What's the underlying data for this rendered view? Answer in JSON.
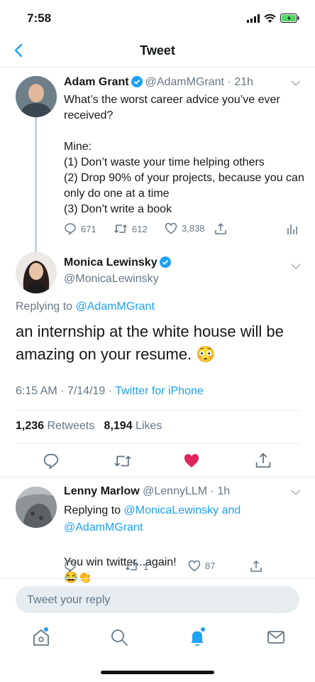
{
  "status": {
    "time": "7:58"
  },
  "header": {
    "title": "Tweet"
  },
  "parent_tweet": {
    "name": "Adam Grant",
    "handle": "@AdamMGrant",
    "time": "21h",
    "text": "What’s the worst career advice you’ve ever received?\n\nMine:\n(1) Don’t waste your time helping others\n(2) Drop 90% of your projects, because you can only do one at a time\n(3) Don’t write a book",
    "replies": "671",
    "retweets": "612",
    "likes": "3,838"
  },
  "main_tweet": {
    "name": "Monica Lewinsky",
    "handle": "@MonicaLewinsky",
    "replying_label": "Replying to",
    "replying_to": "@AdamMGrant",
    "text": "an internship at the white house will be amazing on your resume.",
    "emoji": "😳",
    "time": "6:15 AM",
    "date": "7/14/19",
    "source": "Twitter for iPhone",
    "retweet_count": "1,236",
    "retweet_label": "Retweets",
    "like_count": "8,194",
    "like_label": "Likes",
    "liked_color": "#e0245e"
  },
  "reply_tweet": {
    "name": "Lenny Marlow",
    "handle": "@LennyLLM",
    "time": "1h",
    "replying_label": "Replying to",
    "replying_to_1": "@MonicaLewinsky",
    "and_label": "and",
    "replying_to_2": "@AdamMGrant",
    "text": "You win twitter...again!",
    "emoji": "😂👏",
    "retweets": "1",
    "likes": "87"
  },
  "composer": {
    "placeholder": "Tweet your reply"
  },
  "colors": {
    "accent": "#1da1f2",
    "muted": "#657786",
    "verified": "#1da1f2",
    "battery": "#4cd964"
  }
}
